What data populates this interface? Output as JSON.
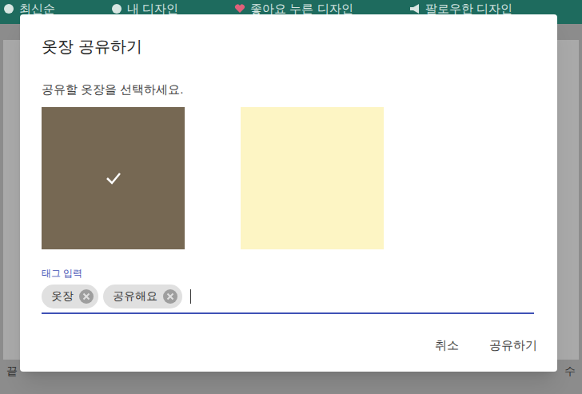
{
  "background": {
    "tabs": [
      {
        "label": "최신순"
      },
      {
        "label": "내 디자인"
      },
      {
        "label": "좋아요 누른 디자인"
      },
      {
        "label": "팔로우한 디자인"
      }
    ],
    "fragments": [
      "끝",
      "수"
    ]
  },
  "dialog": {
    "title": "옷장 공유하기",
    "prompt": "공유할 옷장을 선택하세요.",
    "closets": [
      {
        "selected": true,
        "color": "#8b7b62"
      },
      {
        "selected": false,
        "color": "#fdf5c4"
      }
    ],
    "tag_input": {
      "label": "태그 입력",
      "tags": [
        {
          "label": "옷장"
        },
        {
          "label": "공유해요"
        }
      ]
    },
    "buttons": [
      "취소",
      "공유하기"
    ]
  }
}
